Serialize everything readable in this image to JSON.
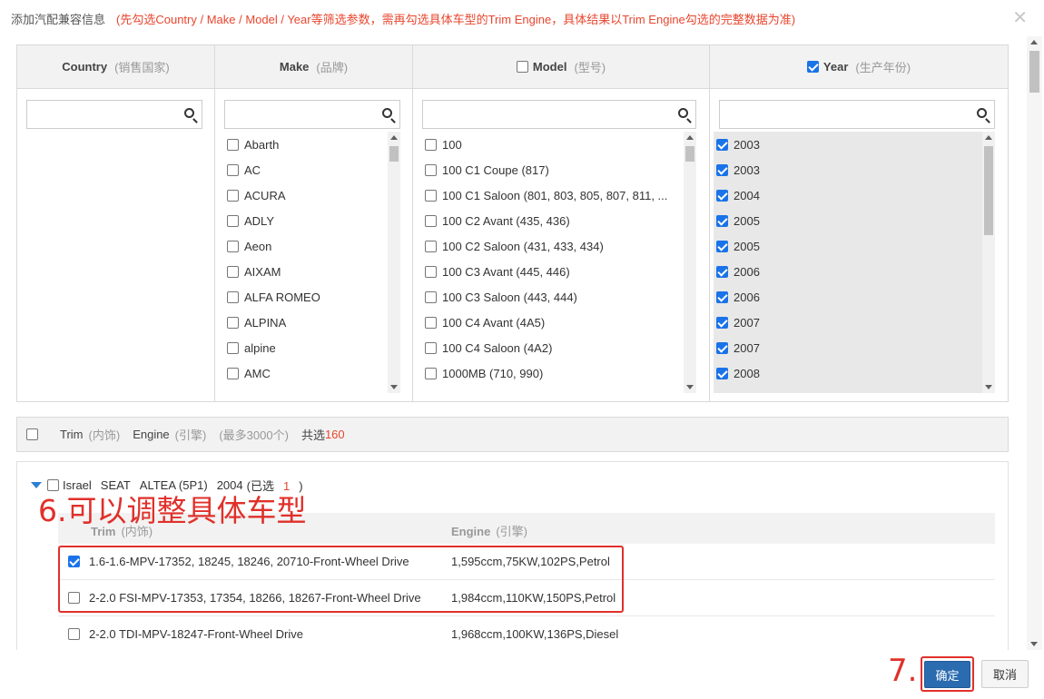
{
  "dialog": {
    "title": "添加汽配兼容信息",
    "hint": "(先勾选Country / Make / Model / Year等筛选参数，需再勾选具体车型的Trim Engine，具体结果以Trim Engine勾选的完整数据为准)",
    "close_icon": "close-icon"
  },
  "columns": {
    "country": {
      "label": "Country",
      "sub": "(销售国家)",
      "search_value": "",
      "items": []
    },
    "make": {
      "label": "Make",
      "sub": "(品牌)",
      "search_value": "",
      "items": [
        {
          "label": "Abarth",
          "checked": false
        },
        {
          "label": "AC",
          "checked": false
        },
        {
          "label": "ACURA",
          "checked": false
        },
        {
          "label": "ADLY",
          "checked": false
        },
        {
          "label": "Aeon",
          "checked": false
        },
        {
          "label": "AIXAM",
          "checked": false
        },
        {
          "label": "ALFA ROMEO",
          "checked": false
        },
        {
          "label": "ALPINA",
          "checked": false
        },
        {
          "label": "alpine",
          "checked": false
        },
        {
          "label": "AMC",
          "checked": false
        }
      ]
    },
    "model": {
      "label": "Model",
      "sub": "(型号)",
      "header_checked": false,
      "search_value": "",
      "items": [
        {
          "label": "100",
          "checked": false
        },
        {
          "label": "100 C1 Coupe (817)",
          "checked": false
        },
        {
          "label": "100 C1 Saloon (801, 803, 805, 807, 811, ...",
          "checked": false
        },
        {
          "label": "100 C2 Avant (435, 436)",
          "checked": false
        },
        {
          "label": "100 C2 Saloon (431, 433, 434)",
          "checked": false
        },
        {
          "label": "100 C3 Avant (445, 446)",
          "checked": false
        },
        {
          "label": "100 C3 Saloon (443, 444)",
          "checked": false
        },
        {
          "label": "100 C4 Avant (4A5)",
          "checked": false
        },
        {
          "label": "100 C4 Saloon (4A2)",
          "checked": false
        },
        {
          "label": "1000MB (710, 990)",
          "checked": false
        }
      ]
    },
    "year": {
      "label": "Year",
      "sub": "(生产年份)",
      "header_checked": true,
      "search_value": "",
      "items": [
        {
          "label": "2003",
          "checked": true
        },
        {
          "label": "2003",
          "checked": true
        },
        {
          "label": "2004",
          "checked": true
        },
        {
          "label": "2005",
          "checked": true
        },
        {
          "label": "2005",
          "checked": true
        },
        {
          "label": "2006",
          "checked": true
        },
        {
          "label": "2006",
          "checked": true
        },
        {
          "label": "2007",
          "checked": true
        },
        {
          "label": "2007",
          "checked": true
        },
        {
          "label": "2008",
          "checked": true
        }
      ]
    }
  },
  "trim_bar": {
    "trim": "Trim",
    "trim_sub": "(内饰)",
    "engine": "Engine",
    "engine_sub": "(引擎)",
    "limit": "(最多3000个)",
    "total_label": "共选",
    "total_count": "160"
  },
  "group": {
    "country": "Israel",
    "make": "SEAT",
    "model": "ALTEA (5P1)",
    "year": "2004",
    "selected_prefix": "(已选",
    "selected_count": "1",
    "selected_suffix": ")",
    "col_trim": "Trim",
    "col_trim_sub": "(内饰)",
    "col_engine": "Engine",
    "col_engine_sub": "(引擎)",
    "rows": [
      {
        "trim": "1.6-1.6-MPV-17352, 18245, 18246, 20710-Front-Wheel Drive",
        "engine": "1,595ccm,75KW,102PS,Petrol",
        "checked": true
      },
      {
        "trim": "2-2.0 FSI-MPV-17353, 17354, 18266, 18267-Front-Wheel Drive",
        "engine": "1,984ccm,110KW,150PS,Petrol",
        "checked": false
      },
      {
        "trim": "2-2.0 TDI-MPV-18247-Front-Wheel Drive",
        "engine": "1,968ccm,100KW,136PS,Diesel",
        "checked": false
      }
    ]
  },
  "annotations": {
    "step6": "6.可以调整具体车型",
    "step7": "7."
  },
  "buttons": {
    "ok": "确定",
    "cancel": "取消"
  },
  "colors": {
    "accent": "#2b6cb0",
    "hint_red": "#e8462e",
    "annotation_red": "#e0302a"
  }
}
